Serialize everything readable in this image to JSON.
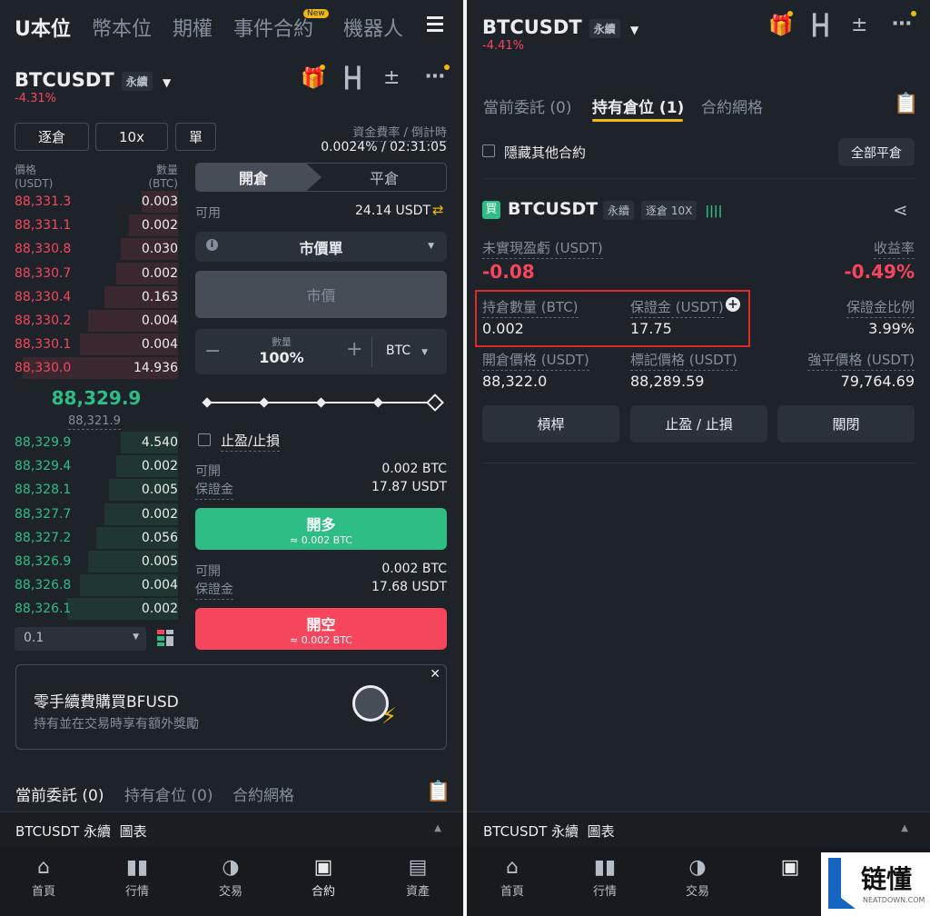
{
  "left": {
    "top_tabs": [
      "U本位",
      "幣本位",
      "期權",
      "事件合約",
      "機器人"
    ],
    "new_badge": "New",
    "menu_icon": "hamburger-icon",
    "symbol": "BTCUSDT",
    "perp_tag": "永續",
    "change": "-4.31%",
    "margin_mode": "逐倉",
    "leverage": "10x",
    "position_mode": "單",
    "funding_label": "資金費率 / 倒計時",
    "funding_value": "0.0024% / 02:31:05",
    "ob_price_label": "價格",
    "ob_price_unit": "(USDT)",
    "ob_qty_label": "數量",
    "ob_qty_unit": "(BTC)",
    "asks": [
      {
        "p": "88,331.3",
        "q": "0.003",
        "d": 0.22
      },
      {
        "p": "88,331.1",
        "q": "0.002",
        "d": 0.3
      },
      {
        "p": "88,330.8",
        "q": "0.030",
        "d": 0.35
      },
      {
        "p": "88,330.7",
        "q": "0.002",
        "d": 0.38
      },
      {
        "p": "88,330.4",
        "q": "0.163",
        "d": 0.45
      },
      {
        "p": "88,330.2",
        "q": "0.004",
        "d": 0.55
      },
      {
        "p": "88,330.1",
        "q": "0.004",
        "d": 0.6
      },
      {
        "p": "88,330.0",
        "q": "14.936",
        "d": 0.95
      }
    ],
    "last_price": "88,329.9",
    "mark_price": "88,321.9",
    "bids": [
      {
        "p": "88,329.9",
        "q": "4.540",
        "d": 0.35
      },
      {
        "p": "88,329.4",
        "q": "0.002",
        "d": 0.38
      },
      {
        "p": "88,328.1",
        "q": "0.005",
        "d": 0.42
      },
      {
        "p": "88,327.7",
        "q": "0.002",
        "d": 0.45
      },
      {
        "p": "88,327.2",
        "q": "0.056",
        "d": 0.5
      },
      {
        "p": "88,326.9",
        "q": "0.005",
        "d": 0.55
      },
      {
        "p": "88,326.8",
        "q": "0.004",
        "d": 0.6
      },
      {
        "p": "88,326.1",
        "q": "0.002",
        "d": 0.68
      }
    ],
    "depth_step": "0.1",
    "open_tab": "開倉",
    "close_tab": "平倉",
    "available_label": "可用",
    "available_value": "24.14 USDT",
    "order_type": "市價單",
    "price_placeholder": "市價",
    "qty_label": "數量",
    "qty_value": "100%",
    "qty_unit": "BTC",
    "slider_fraction": 1.0,
    "tpsl_label": "止盈/止損",
    "long_open_label": "可開",
    "long_open_value": "0.002 BTC",
    "long_margin_label": "保證金",
    "long_margin_value": "17.87 USDT",
    "long_btn": "開多",
    "long_btn_sub": "≈ 0.002 BTC",
    "short_open_label": "可開",
    "short_open_value": "0.002 BTC",
    "short_margin_label": "保證金",
    "short_margin_value": "17.68 USDT",
    "short_btn": "開空",
    "short_btn_sub": "≈ 0.002 BTC",
    "promo_title": "零手續費購買BFUSD",
    "promo_sub": "持有並在交易時享有額外獎勵",
    "bottom_tabs": [
      "當前委託 (0)",
      "持有倉位 (0)",
      "合約網格"
    ],
    "chart_bar": "BTCUSDT 永續  圖表",
    "nav": [
      "首頁",
      "行情",
      "交易",
      "合約",
      "資產"
    ]
  },
  "right": {
    "symbol": "BTCUSDT",
    "perp_tag": "永續",
    "change": "-4.41%",
    "tabs": [
      "當前委託 (0)",
      "持有倉位 (1)",
      "合約網格"
    ],
    "hide_other": "隱藏其他合約",
    "close_all": "全部平倉",
    "pos_side": "買",
    "pos_symbol": "BTCUSDT",
    "pos_perp": "永續",
    "pos_margin": "逐倉 10X",
    "pnl_label": "未實現盈虧 (USDT)",
    "pnl_value": "-0.08",
    "roe_label": "收益率",
    "roe_value": "-0.49%",
    "size_label": "持倉數量 (BTC)",
    "size_value": "0.002",
    "margin_label": "保證金 (USDT)",
    "margin_value": "17.75",
    "margin_ratio_label": "保證金比例",
    "margin_ratio_value": "3.99%",
    "entry_label": "開倉價格 (USDT)",
    "entry_value": "88,322.0",
    "mark_label": "標記價格 (USDT)",
    "mark_value": "88,289.59",
    "liq_label": "強平價格 (USDT)",
    "liq_value": "79,764.69",
    "btn_leverage": "槓桿",
    "btn_tpsl": "止盈 / 止損",
    "btn_close": "關閉",
    "chart_bar": "BTCUSDT 永續  圖表",
    "nav": [
      "首頁",
      "行情",
      "交易"
    ]
  },
  "watermark": {
    "brand": "链懂",
    "url": "NEATDOWN.COM"
  }
}
